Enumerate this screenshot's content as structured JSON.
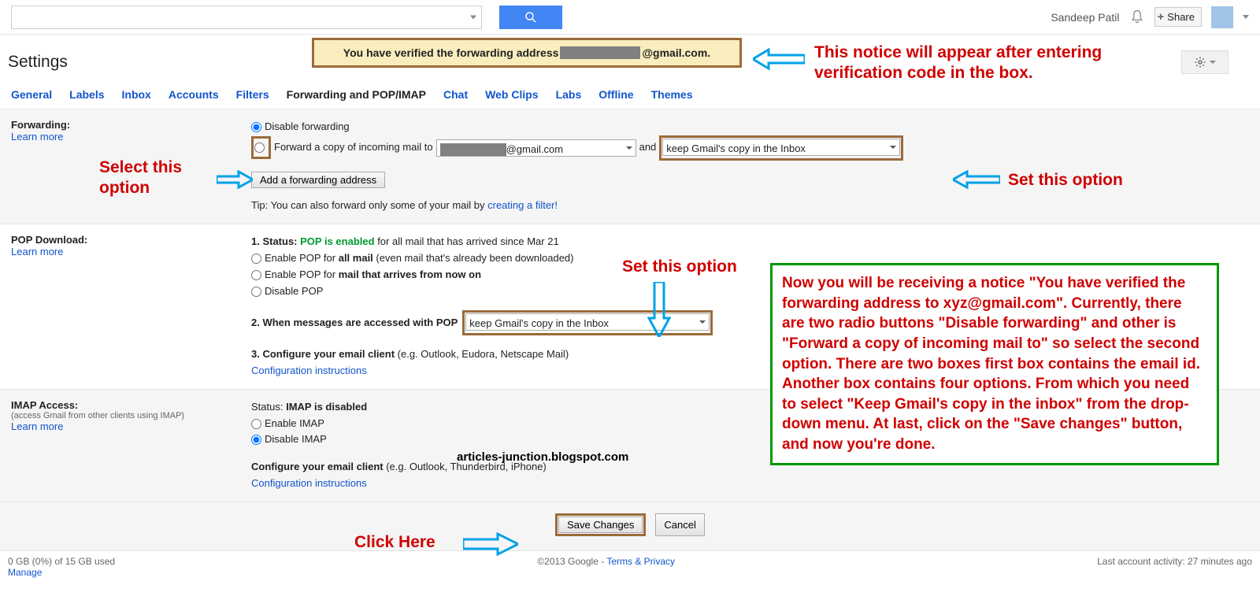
{
  "top": {
    "username": "Sandeep Patil",
    "share": "Share"
  },
  "banner": {
    "prefix": "You have verified the forwarding address",
    "domain": "@gmail.com."
  },
  "settings_title": "Settings",
  "tabs": [
    "General",
    "Labels",
    "Inbox",
    "Accounts",
    "Filters",
    "Forwarding and POP/IMAP",
    "Chat",
    "Web Clips",
    "Labs",
    "Offline",
    "Themes"
  ],
  "active_tab_index": 5,
  "forwarding": {
    "label": "Forwarding:",
    "learn_more": "Learn more",
    "disable": "Disable forwarding",
    "forward_prefix": "Forward a copy of incoming mail to",
    "email_domain": "@gmail.com",
    "and": "and",
    "keep_copy": "keep Gmail's copy in the Inbox",
    "add_btn": "Add a forwarding address",
    "tip_prefix": "Tip: You can also forward only some of your mail by ",
    "tip_link": "creating a filter!"
  },
  "pop": {
    "label": "POP Download:",
    "learn_more": "Learn more",
    "status_num": "1. Status:",
    "status_val": "POP is enabled",
    "status_suffix": "for all mail that has arrived since Mar 21",
    "opt_all_prefix": "Enable POP for ",
    "opt_all_bold": "all mail",
    "opt_all_suffix": " (even mail that's already been downloaded)",
    "opt_now_prefix": "Enable POP for ",
    "opt_now_bold": "mail that arrives from now on",
    "opt_disable": "Disable POP",
    "item2": "2. When messages are accessed with POP",
    "pop_copy": "keep Gmail's copy in the Inbox",
    "item3_prefix": "3. Configure your email client ",
    "item3_suffix": "(e.g. Outlook, Eudora, Netscape Mail)",
    "config_link": "Configuration instructions"
  },
  "imap": {
    "label": "IMAP Access:",
    "sub": "(access Gmail from other clients using IMAP)",
    "learn_more": "Learn more",
    "status_prefix": "Status: ",
    "status_bold": "IMAP is disabled",
    "enable": "Enable IMAP",
    "disable": "Disable IMAP",
    "config_prefix": "Configure your email client ",
    "config_suffix": "(e.g. Outlook, Thunderbird, iPhone)",
    "config_link": "Configuration instructions"
  },
  "actions": {
    "save": "Save Changes",
    "cancel": "Cancel"
  },
  "footer": {
    "storage": "0 GB (0%) of 15 GB used",
    "manage": "Manage",
    "copyright": "©2013 Google - ",
    "terms": "Terms & Privacy",
    "activity": "Last account activity: 27 minutes ago"
  },
  "annotations": {
    "top_right": "This notice will appear after entering verification code in the box.",
    "select_option": "Select this option",
    "set_option_right": "Set this option",
    "set_option_mid": "Set this option",
    "click_here": "Click Here",
    "green_box": "Now you will be receiving a notice \"You have verified the forwarding address to xyz@gmail.com\". Currently, there are two radio buttons \"Disable forwarding\" and other is \"Forward a copy of incoming mail to\" so select the second option. There are two boxes first box contains the email id. Another box contains four options. From which you need to select \"Keep Gmail's copy in the inbox\" from the drop-down menu. At last, click on the \"Save changes\" button, and now you're done."
  },
  "watermark": "articles-junction.blogspot.com"
}
